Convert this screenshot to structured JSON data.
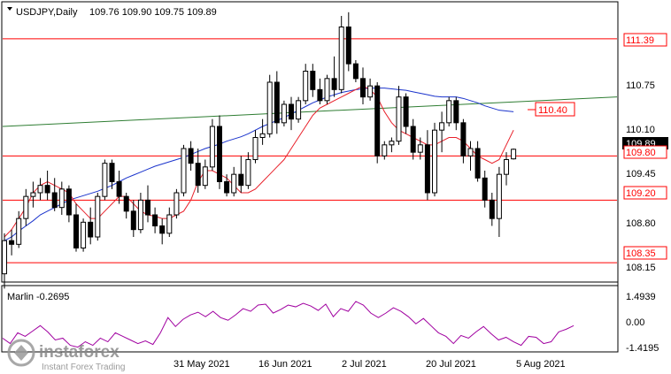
{
  "header": {
    "symbol": "USDJPY,Daily",
    "ohlc": "109.76 109.90 109.75 109.89"
  },
  "indicator": {
    "label": "Marlin -0.2695",
    "scale": [
      "1.4939",
      "0.00",
      "-1.4195"
    ]
  },
  "price_labels": {
    "r1": "111.39",
    "r2": "110.40",
    "r3": "109.80",
    "r4": "109.20",
    "r5": "108.35",
    "current": "109.89"
  },
  "price_axis": [
    "110.75",
    "110.10",
    "109.45",
    "108.80",
    "108.15"
  ],
  "date_axis": [
    "31 May 2021",
    "16 Jun 2021",
    "2 Jul 2021",
    "20 Jul 2021",
    "5 Aug 2021"
  ],
  "logo": {
    "name": "instaforex",
    "tagline": "Instant Forex Trading"
  },
  "colors": {
    "bull": "#ffffff",
    "bear": "#000000",
    "level": "#ff0000",
    "ma_red": "#e8202a",
    "ma_blue": "#1a33cc",
    "ma_green": "#2e7d32",
    "marlin": "#a000a0"
  },
  "chart_data": {
    "type": "candlestick",
    "title": "USDJPY,Daily",
    "ylim": [
      108.1,
      111.88
    ],
    "horizontal_levels": [
      111.39,
      110.4,
      109.8,
      109.2,
      108.35
    ],
    "last_price": 109.89,
    "candles": [
      [
        108.2,
        108.75,
        108.0,
        108.65
      ],
      [
        108.65,
        108.8,
        108.45,
        108.6
      ],
      [
        108.6,
        109.05,
        108.55,
        108.95
      ],
      [
        108.95,
        109.35,
        108.85,
        109.25
      ],
      [
        109.25,
        109.45,
        109.1,
        109.3
      ],
      [
        109.3,
        109.5,
        109.2,
        109.4
      ],
      [
        109.4,
        109.6,
        109.2,
        109.3
      ],
      [
        109.3,
        109.5,
        109.05,
        109.1
      ],
      [
        109.1,
        109.45,
        109.0,
        109.35
      ],
      [
        109.35,
        109.4,
        108.9,
        109.0
      ],
      [
        109.0,
        109.15,
        108.5,
        108.55
      ],
      [
        108.55,
        108.95,
        108.5,
        108.9
      ],
      [
        108.9,
        109.1,
        108.6,
        108.7
      ],
      [
        108.7,
        109.3,
        108.65,
        109.25
      ],
      [
        109.25,
        109.75,
        109.2,
        109.7
      ],
      [
        109.7,
        109.75,
        109.35,
        109.45
      ],
      [
        109.45,
        109.6,
        109.15,
        109.25
      ],
      [
        109.25,
        109.3,
        108.95,
        109.05
      ],
      [
        109.05,
        109.2,
        108.7,
        108.8
      ],
      [
        108.8,
        109.3,
        108.75,
        109.2
      ],
      [
        109.2,
        109.4,
        108.9,
        109.0
      ],
      [
        109.0,
        109.1,
        108.75,
        108.85
      ],
      [
        108.85,
        108.95,
        108.6,
        108.75
      ],
      [
        108.75,
        109.1,
        108.7,
        109.0
      ],
      [
        109.0,
        109.35,
        108.95,
        109.3
      ],
      [
        109.3,
        109.95,
        109.25,
        109.9
      ],
      [
        109.9,
        110.0,
        109.6,
        109.7
      ],
      [
        109.7,
        109.9,
        109.3,
        109.4
      ],
      [
        109.4,
        109.75,
        109.35,
        109.65
      ],
      [
        109.65,
        110.3,
        109.6,
        110.2
      ],
      [
        110.2,
        110.35,
        109.35,
        109.45
      ],
      [
        109.45,
        109.55,
        109.25,
        109.3
      ],
      [
        109.3,
        109.65,
        109.25,
        109.55
      ],
      [
        109.55,
        109.8,
        109.3,
        109.4
      ],
      [
        109.4,
        109.85,
        109.35,
        109.75
      ],
      [
        109.75,
        110.15,
        109.7,
        110.05
      ],
      [
        110.05,
        110.3,
        109.95,
        110.1
      ],
      [
        110.1,
        110.9,
        110.05,
        110.8
      ],
      [
        110.8,
        110.95,
        110.1,
        110.25
      ],
      [
        110.25,
        110.55,
        110.2,
        110.5
      ],
      [
        110.5,
        110.6,
        110.15,
        110.3
      ],
      [
        110.3,
        110.6,
        110.25,
        110.55
      ],
      [
        110.55,
        111.05,
        110.5,
        110.95
      ],
      [
        110.95,
        111.05,
        110.6,
        110.7
      ],
      [
        110.7,
        110.85,
        110.5,
        110.55
      ],
      [
        110.55,
        110.9,
        110.5,
        110.85
      ],
      [
        110.85,
        111.15,
        110.6,
        110.7
      ],
      [
        110.7,
        111.7,
        110.65,
        111.55
      ],
      [
        111.55,
        111.75,
        110.95,
        111.05
      ],
      [
        111.05,
        111.1,
        110.8,
        110.85
      ],
      [
        110.85,
        111.0,
        110.5,
        110.6
      ],
      [
        110.6,
        110.85,
        110.55,
        110.75
      ],
      [
        110.75,
        110.8,
        109.7,
        109.8
      ],
      [
        109.8,
        110.0,
        109.75,
        109.95
      ],
      [
        109.95,
        110.05,
        109.85,
        110.0
      ],
      [
        110.0,
        110.75,
        109.95,
        110.6
      ],
      [
        110.6,
        110.65,
        110.1,
        110.2
      ],
      [
        110.2,
        110.3,
        109.75,
        109.85
      ],
      [
        109.85,
        110.05,
        109.75,
        109.95
      ],
      [
        109.95,
        110.15,
        109.2,
        109.3
      ],
      [
        109.3,
        110.25,
        109.25,
        110.15
      ],
      [
        110.15,
        110.4,
        109.85,
        110.25
      ],
      [
        110.25,
        110.6,
        110.2,
        110.55
      ],
      [
        110.55,
        110.6,
        110.15,
        110.25
      ],
      [
        110.25,
        110.3,
        109.7,
        109.8
      ],
      [
        109.8,
        110.0,
        109.6,
        109.9
      ],
      [
        109.9,
        110.0,
        109.45,
        109.5
      ],
      [
        109.5,
        109.6,
        109.1,
        109.2
      ],
      [
        109.2,
        109.3,
        108.85,
        108.95
      ],
      [
        108.95,
        109.65,
        108.7,
        109.55
      ],
      [
        109.55,
        109.85,
        109.4,
        109.75
      ],
      [
        109.76,
        109.9,
        109.75,
        109.89
      ]
    ],
    "ma_fast_red": [
      108.7,
      108.8,
      108.95,
      109.1,
      109.3,
      109.4,
      109.45,
      109.4,
      109.35,
      109.3,
      109.15,
      109.05,
      108.95,
      108.95,
      109.05,
      109.15,
      109.25,
      109.25,
      109.15,
      109.05,
      109.0,
      108.98,
      108.95,
      108.95,
      109.0,
      109.05,
      109.2,
      109.45,
      109.6,
      109.6,
      109.55,
      109.5,
      109.4,
      109.3,
      109.3,
      109.35,
      109.45,
      109.55,
      109.65,
      109.75,
      109.9,
      110.05,
      110.2,
      110.35,
      110.45,
      110.5,
      110.55,
      110.6,
      110.65,
      110.7,
      110.75,
      110.7,
      110.6,
      110.4,
      110.25,
      110.15,
      110.1,
      110.05,
      110.0,
      109.95,
      109.95,
      110.0,
      110.05,
      110.05,
      110.0,
      109.9,
      109.8,
      109.75,
      109.7,
      109.75,
      109.95,
      110.15
    ],
    "ma_mid_blue": [
      108.65,
      108.7,
      108.78,
      108.85,
      108.92,
      109.0,
      109.05,
      109.1,
      109.15,
      109.2,
      109.23,
      109.26,
      109.29,
      109.32,
      109.36,
      109.4,
      109.45,
      109.5,
      109.54,
      109.58,
      109.62,
      109.66,
      109.69,
      109.72,
      109.75,
      109.78,
      109.82,
      109.86,
      109.9,
      109.93,
      109.96,
      110.0,
      110.03,
      110.06,
      110.1,
      110.15,
      110.2,
      110.24,
      110.28,
      110.32,
      110.37,
      110.42,
      110.47,
      110.52,
      110.56,
      110.6,
      110.63,
      110.66,
      110.68,
      110.7,
      110.71,
      110.72,
      110.72,
      110.72,
      110.71,
      110.7,
      110.69,
      110.67,
      110.65,
      110.63,
      110.61,
      110.6,
      110.6,
      110.6,
      110.58,
      110.55,
      110.52,
      110.48,
      110.45,
      110.42,
      110.41,
      110.4
    ],
    "ma_slow_green": [
      110.2,
      110.6
    ],
    "marlin": [
      -0.9,
      -1.2,
      -0.6,
      -0.8,
      -0.5,
      -0.2,
      -0.55,
      -1.0,
      -0.9,
      -1.3,
      -1.4,
      -1.1,
      -1.3,
      -0.9,
      -1.1,
      -0.6,
      -0.8,
      -1.0,
      -1.2,
      -1.05,
      -1.25,
      -0.6,
      0.25,
      -0.25,
      0.15,
      0.4,
      0.55,
      0.3,
      0.6,
      0.25,
      0.1,
      0.4,
      0.75,
      0.6,
      0.95,
      1.0,
      0.5,
      0.7,
      0.95,
      0.85,
      1.05,
      0.9,
      0.65,
      1.0,
      0.3,
      0.75,
      0.6,
      1.15,
      0.95,
      0.5,
      0.25,
      0.5,
      0.8,
      0.6,
      0.3,
      -0.1,
      0.2,
      -0.2,
      -0.6,
      -0.8,
      -1.2,
      -0.75,
      -0.9,
      -0.55,
      -0.25,
      -0.65,
      -1.0,
      -0.85,
      -1.1,
      -1.3,
      -0.8,
      -0.85,
      -1.2,
      -1.1,
      -0.55,
      -0.4,
      -0.2
    ]
  }
}
